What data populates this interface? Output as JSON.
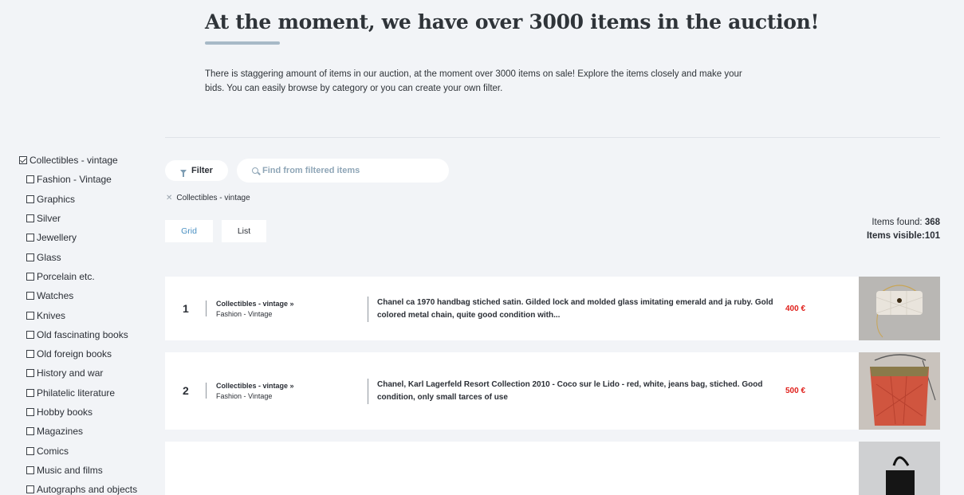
{
  "hero": {
    "title": "At the moment, we have over 3000 items in the auction!",
    "description": "There is staggering amount of items in our auction, at the moment over 3000 items on sale! Explore the items closely and make your bids. You can easily browse by category or you can create your own filter."
  },
  "sidebar": {
    "categories": [
      {
        "label": "Collectibles - vintage",
        "checked": true
      },
      {
        "label": "Fashion - Vintage",
        "checked": false
      },
      {
        "label": "Graphics",
        "checked": false
      },
      {
        "label": "Silver",
        "checked": false
      },
      {
        "label": "Jewellery",
        "checked": false
      },
      {
        "label": "Glass",
        "checked": false
      },
      {
        "label": "Porcelain etc.",
        "checked": false
      },
      {
        "label": "Watches",
        "checked": false
      },
      {
        "label": "Knives",
        "checked": false
      },
      {
        "label": "Old fascinating books",
        "checked": false
      },
      {
        "label": "Old foreign books",
        "checked": false
      },
      {
        "label": "History and war",
        "checked": false
      },
      {
        "label": "Philatelic literature",
        "checked": false
      },
      {
        "label": "Hobby books",
        "checked": false
      },
      {
        "label": "Magazines",
        "checked": false
      },
      {
        "label": "Comics",
        "checked": false
      },
      {
        "label": "Music and films",
        "checked": false
      },
      {
        "label": "Autographs and objects",
        "checked": false
      }
    ]
  },
  "toolbar": {
    "filter_label": "Filter",
    "search_placeholder": "Find from filtered items",
    "active_filter": "Collectibles - vintage",
    "view_grid": "Grid",
    "view_list": "List"
  },
  "stats": {
    "found_label": "Items found:",
    "found_value": "368",
    "visible_label": "Items visible:",
    "visible_value": "101"
  },
  "items": [
    {
      "num": "1",
      "category": "Collectibles - vintage »",
      "subcategory": "Fashion - Vintage",
      "description": "Chanel ca 1970 handbag stiched satin. Gilded lock and molded glass imitating emerald and ja ruby. Gold colored metal chain, quite good condition with...",
      "price": "400 €"
    },
    {
      "num": "2",
      "category": "Collectibles - vintage »",
      "subcategory": "Fashion - Vintage",
      "description": "Chanel, Karl Lagerfeld Resort Collection 2010 - Coco sur le Lido - red, white, jeans bag, stiched. Good condition, only small tarces of use",
      "price": "500 €"
    }
  ],
  "colors": {
    "accent": "#4a90c2",
    "price": "#e0201b",
    "background": "#f2f4f7"
  }
}
